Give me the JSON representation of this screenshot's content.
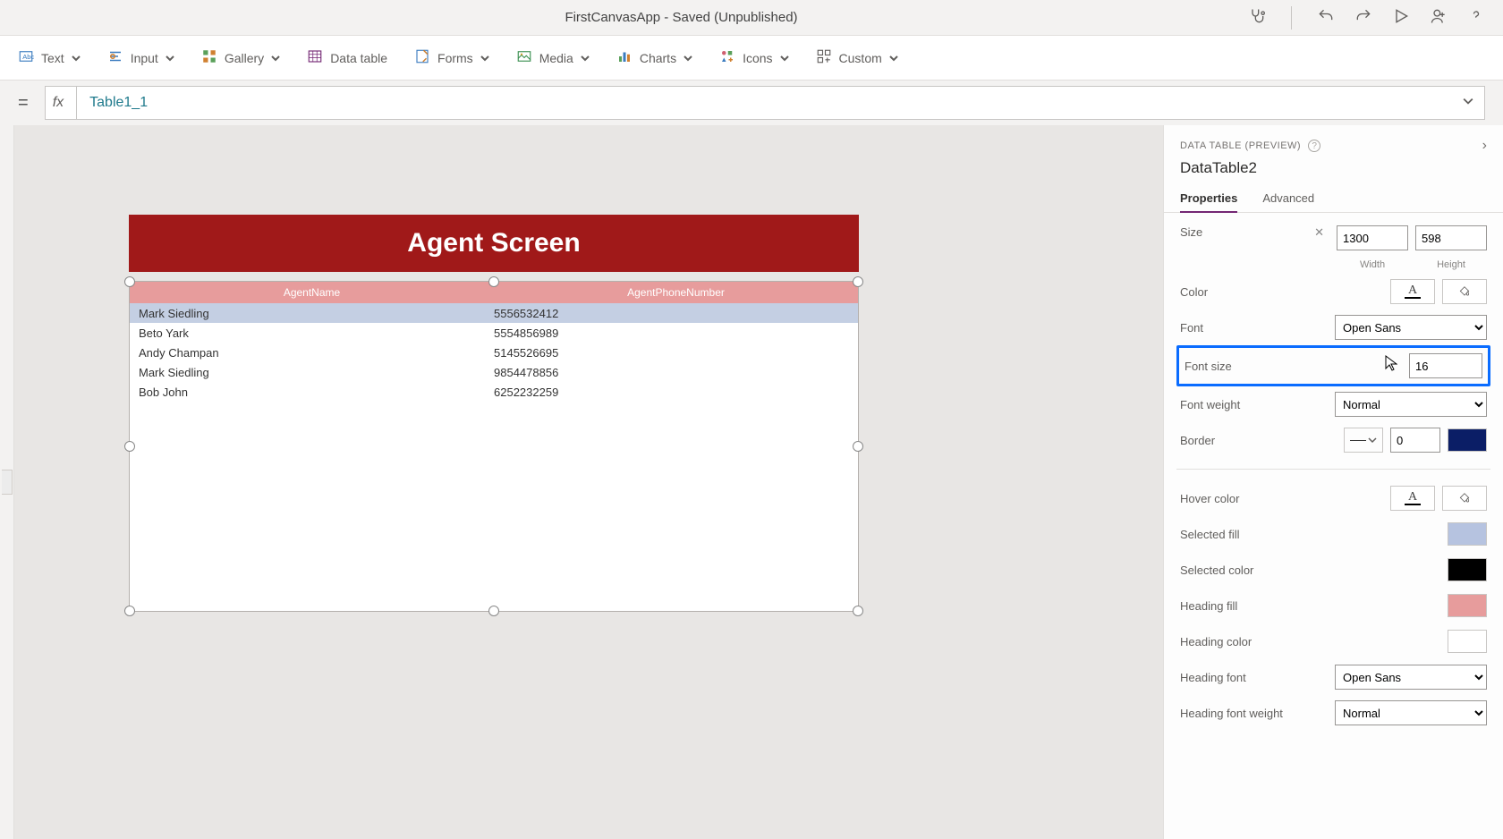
{
  "titleBar": {
    "appTitle": "FirstCanvasApp - Saved (Unpublished)"
  },
  "ribbon": {
    "text": "Text",
    "input": "Input",
    "gallery": "Gallery",
    "dataTable": "Data table",
    "forms": "Forms",
    "media": "Media",
    "charts": "Charts",
    "icons": "Icons",
    "custom": "Custom"
  },
  "formulaBar": {
    "prefix": "=",
    "fx": "fx",
    "expression": "Table1_1"
  },
  "canvas": {
    "screenTitle": "Agent Screen",
    "columns": [
      "AgentName",
      "AgentPhoneNumber"
    ],
    "rows": [
      {
        "name": "Mark Siedling",
        "phone": "5556532412"
      },
      {
        "name": "Beto Yark",
        "phone": "5554856989"
      },
      {
        "name": "Andy Champan",
        "phone": "5145526695"
      },
      {
        "name": "Mark Siedling",
        "phone": "9854478856"
      },
      {
        "name": "Bob John",
        "phone": "6252232259"
      }
    ]
  },
  "propsPanel": {
    "sectionLabel": "DATA TABLE (PREVIEW)",
    "elementName": "DataTable2",
    "tabs": {
      "properties": "Properties",
      "advanced": "Advanced"
    },
    "size": {
      "label": "Size",
      "width": "1300",
      "height": "598",
      "widthLabel": "Width",
      "heightLabel": "Height"
    },
    "color": {
      "label": "Color"
    },
    "font": {
      "label": "Font",
      "value": "Open Sans"
    },
    "fontSize": {
      "label": "Font size",
      "value": "16"
    },
    "fontWeight": {
      "label": "Font weight",
      "value": "Normal"
    },
    "border": {
      "label": "Border",
      "width": "0",
      "color": "#0b1e66"
    },
    "hoverColor": {
      "label": "Hover color"
    },
    "selectedFill": {
      "label": "Selected fill",
      "color": "#b6c3e0"
    },
    "selectedColor": {
      "label": "Selected color",
      "color": "#000000"
    },
    "headingFill": {
      "label": "Heading fill",
      "color": "#e79c9c"
    },
    "headingColor": {
      "label": "Heading color",
      "color": "#ffffff"
    },
    "headingFont": {
      "label": "Heading font",
      "value": "Open Sans"
    },
    "headingFontWeight": {
      "label": "Heading font weight",
      "value": "Normal"
    }
  }
}
